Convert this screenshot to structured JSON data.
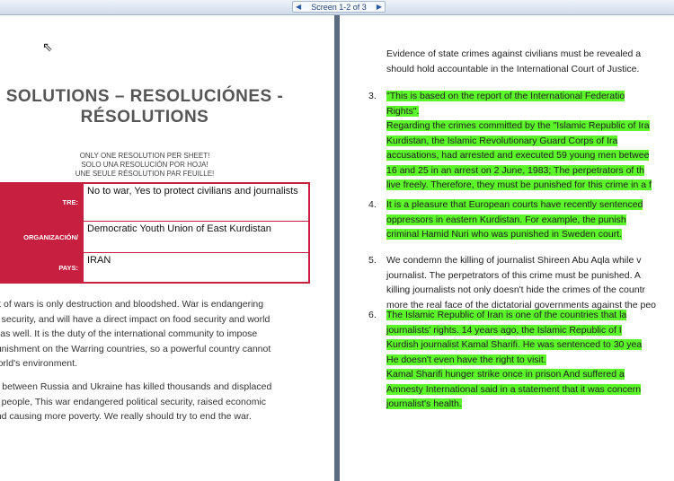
{
  "toolbar": {
    "screen_label": "Screen 1-2 of 3",
    "prev_icon": "triangle-left",
    "next_icon": "triangle-right"
  },
  "left": {
    "title_line1": "SOLUTIONS – RESOLUCIÓNES -",
    "title_line2": "RÉSOLUTIONS",
    "rule_lines": [
      "ONLY ONE RESOLUTION PER SHEET!",
      "SOLO UNA RESOLUCIÓN POR HOJA!",
      "UNE SEULE RÉSOLUTION PAR FEUILLE!"
    ],
    "form": [
      {
        "label": "TRE:",
        "value": "No to war, Yes to protect civilians and journalists"
      },
      {
        "label": "ORGANIZACIÓN/",
        "value": "Democratic Youth Union of East Kurdistan"
      },
      {
        "label": "PAYS:",
        "value": "IRAN"
      }
    ],
    "para1": [
      "ult of wars is only destruction and bloodshed. War is endangering",
      "fe security, and will have a direct impact on food security and world",
      "y, as well. It is the duty of the international community to impose",
      "punishment on the Warring countries, so a powerful country cannot",
      "world's environment."
    ],
    "para2": [
      "ar between Russia and Ukraine has killed thousands and displaced",
      "of people, This war endangered political security, raised economic",
      "and causing more poverty. We really should try to end the war."
    ]
  },
  "right": {
    "intro": [
      "Evidence of state crimes against civilians must be revealed a",
      "should hold accountable in the International Court of Justice."
    ],
    "items": [
      {
        "num": "3.",
        "lines": [
          "\"This is based on the report of the International Federatio",
          "Rights\".",
          "Regarding the crimes committed by the \"Islamic Republic of Ira",
          "Kurdistan, the Islamic Revolutionary Guard Corps of Ira",
          "accusations, had arrested and executed 59 young men betwee",
          "16 and 25 in an arrest on 2 June, 1983; The perpetrators of th",
          "live freely. Therefore, they must be punished for this crime in a f"
        ]
      },
      {
        "num": "4.",
        "lines": [
          "It is a pleasure that European courts have recently sentenced",
          "oppressors in eastern Kurdistan. For example, the punish",
          "criminal Hamid Nuri who was punished in Sweden court."
        ]
      },
      {
        "num": "5.",
        "lines": [
          "We condemn the killing of journalist Shireen Abu Aqla while v",
          "journalist. The perpetrators of this crime must be punished. A",
          "killing journalists not only doesn't hide the crimes of the countr",
          "more the real face of the dictatorial governments against the peo"
        ]
      },
      {
        "num": "6.",
        "lines": [
          "The Islamic Republic of Iran is one of the countries that la",
          "journalists' rights. 14 years ago, the Islamic Republic of I",
          "Kurdish journalist Kamal Sharifi. He was sentenced to 30 yea",
          "He doesn't even have the right to visit.",
          "Kamal Sharifi hunger strike once in prison And suffered a",
          "Amnesty International said in a statement that it was concern",
          "journalist's health."
        ]
      }
    ]
  }
}
